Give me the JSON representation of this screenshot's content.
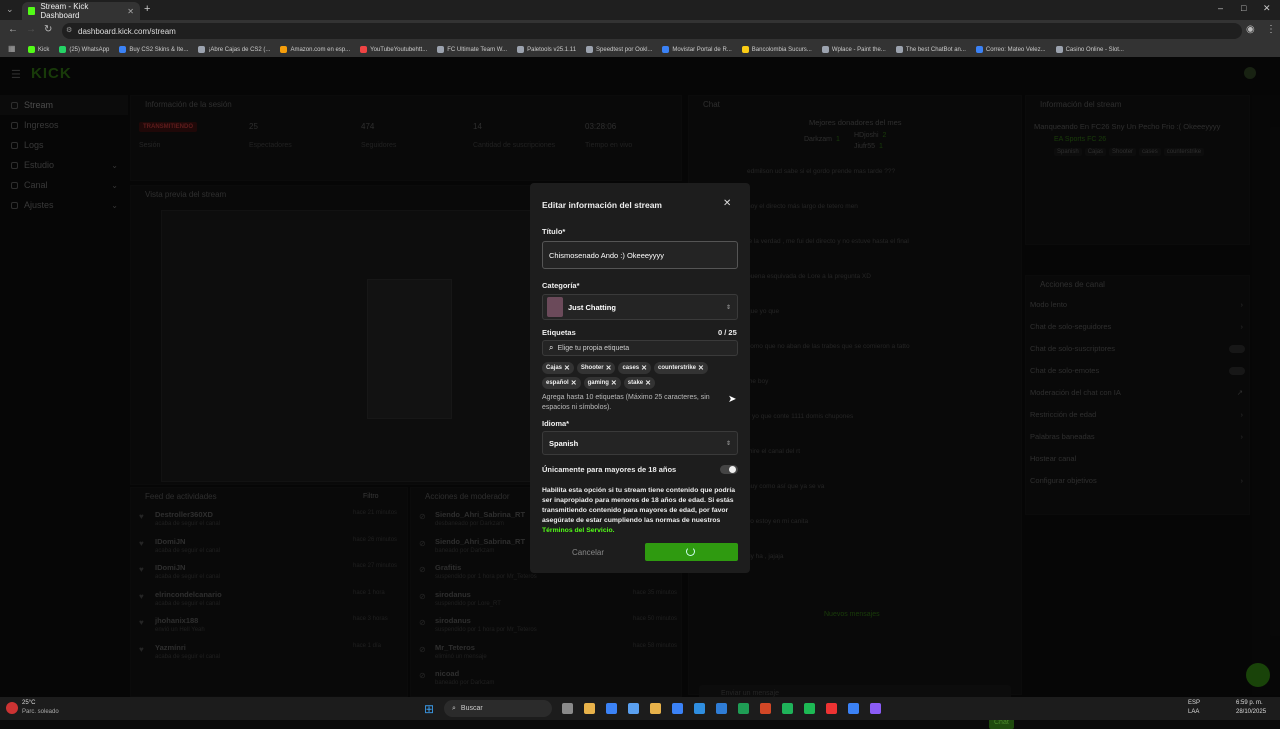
{
  "browser": {
    "tab_title": "Stream - Kick Dashboard",
    "new_tab": "+",
    "url": "dashboard.kick.com/stream",
    "window_controls": [
      "–",
      "□",
      "✕"
    ],
    "bookmarks": [
      {
        "label": "Kick",
        "color": "#53fc18"
      },
      {
        "label": "(25) WhatsApp",
        "color": "#25d366"
      },
      {
        "label": "Buy CS2 Skins & Ite...",
        "color": "#3b82f6"
      },
      {
        "label": "¡Abre Cajas de CS2 (...",
        "color": "#9ca3af"
      },
      {
        "label": "Amazon.com en esp...",
        "color": "#f59e0b"
      },
      {
        "label": "YouTubeYoutubehtt...",
        "color": "#ef4444"
      },
      {
        "label": "FC Ultimate Team W...",
        "color": "#9ca3af"
      },
      {
        "label": "Paletools v25.1.11",
        "color": "#9ca3af"
      },
      {
        "label": "Speedtest por Ookl...",
        "color": "#9ca3af"
      },
      {
        "label": "Movistar Portal de R...",
        "color": "#3b82f6"
      },
      {
        "label": "Bancolombia Sucurs...",
        "color": "#facc15"
      },
      {
        "label": "Wplace - Paint the...",
        "color": "#9ca3af"
      },
      {
        "label": "The best ChatBot an...",
        "color": "#9ca3af"
      },
      {
        "label": "Correo: Mateo Velez...",
        "color": "#3b82f6"
      },
      {
        "label": "Casino Online - Slot...",
        "color": "#9ca3af"
      }
    ]
  },
  "app": {
    "logo": "KICK",
    "sidebar": [
      {
        "label": "Stream",
        "icon": "video-icon",
        "active": true
      },
      {
        "label": "Ingresos",
        "icon": "dollar-icon"
      },
      {
        "label": "Logs",
        "icon": "list-icon"
      },
      {
        "label": "Estudio",
        "icon": "studio-icon",
        "chevron": true
      },
      {
        "label": "Canal",
        "icon": "channel-icon",
        "chevron": true
      },
      {
        "label": "Ajustes",
        "icon": "gear-icon",
        "chevron": true
      }
    ],
    "session": {
      "title": "Información de la sesión",
      "status": "TRANSMITIENDO",
      "stats": [
        {
          "value": "25",
          "label": "Espectadores"
        },
        {
          "value": "474",
          "label": "Seguidores"
        },
        {
          "value": "14",
          "label": "Cantidad de suscripciones"
        },
        {
          "value": "03:28:06",
          "label": "Tiempo en vivo"
        }
      ],
      "session_label": "Sesión"
    },
    "preview_title": "Vista previa del stream",
    "activity": {
      "title": "Feed de actividades",
      "filter": "Filtro",
      "items": [
        {
          "name": "Destroller360XD",
          "desc": "acaba de seguir el canal",
          "time": "hace 21 minutos"
        },
        {
          "name": "IDomiJN",
          "desc": "acaba de seguir el canal",
          "time": "hace 26 minutos"
        },
        {
          "name": "IDomiJN",
          "desc": "acaba de seguir el canal",
          "time": "hace 27 minutos"
        },
        {
          "name": "elrincondelcanario",
          "desc": "acaba de seguir el canal",
          "time": "hace 1 hora"
        },
        {
          "name": "jhohanix188",
          "desc": "envió un Hell Yeah",
          "time": "hace 3 horas"
        },
        {
          "name": "Yazmínri",
          "desc": "acaba de seguir el canal",
          "time": "hace 1 día"
        }
      ]
    },
    "mod_actions": {
      "title": "Acciones de moderador",
      "items": [
        {
          "name": "Siendo_Ahri_Sabrina_RT",
          "desc": "desbaneado por Darkzam"
        },
        {
          "name": "Siendo_Ahri_Sabrina_RT",
          "desc": "baneado por Darkzam"
        },
        {
          "name": "Grafitis",
          "desc": "suspendido por 1 hora por Mr_Teteros"
        },
        {
          "name": "sirodanus",
          "desc": "suspendido por Lore_RT",
          "time": "hace 35 minutos"
        },
        {
          "name": "sirodanus",
          "desc": "suspendido por 1 hora por Mr_Teteros",
          "time": "hace 50 minutos"
        },
        {
          "name": "Mr_Teteros",
          "desc": "eliminó un mensaje",
          "time": "hace 58 minutos"
        },
        {
          "name": "nicoad",
          "desc": "baneado por Darkzam"
        }
      ]
    },
    "chat": {
      "title": "Chat",
      "donors_title": "Mejores donadores del mes",
      "donors": [
        {
          "name": "Darkzam",
          "count": "1"
        },
        {
          "name": "HDjoshi",
          "count": "2"
        },
        {
          "name": "Jiufr55",
          "count": "1"
        }
      ],
      "new_messages": "Nuevos mensajes",
      "input_placeholder": "Enviar un mensaje",
      "send": "Chat",
      "messages": [
        "edmilson ud sabe si el gordo prende mas tarde ???",
        "hoy el directo más largo de tetero men",
        "le la verdad , me fui del directo y no estuve hasta el final",
        "buena esquivada de Lore a la pregunta XD",
        "que yo que",
        "como que no aban de las trabes que se comieron a tatto",
        "me boy",
        "y yo que conte 1111 domis chupones",
        "mire el canal del rt",
        "huy como así que ya se va",
        "yo estoy en mi canita",
        "uy ha , jajaja"
      ]
    },
    "stream_info": {
      "title": "Información del stream",
      "stream_title": "Manqueando En FC26 Sny Un Pecho Frio :( Okeeeyyyy",
      "game": "EA Sports FC 26",
      "tags": [
        "Spanish",
        "Cajas",
        "Shooter",
        "cases",
        "counterstrike"
      ]
    },
    "channel_actions": {
      "title": "Acciones de canal",
      "items": [
        {
          "label": "Modo lento",
          "type": "chevron"
        },
        {
          "label": "Chat de solo-seguidores",
          "type": "chevron"
        },
        {
          "label": "Chat de solo-suscriptores",
          "type": "toggle"
        },
        {
          "label": "Chat de solo-emotes",
          "type": "toggle"
        },
        {
          "label": "Moderación del chat con IA",
          "type": "link"
        },
        {
          "label": "Restricción de edad",
          "type": "chevron"
        },
        {
          "label": "Palabras baneadas",
          "type": "chevron"
        },
        {
          "label": "Hostear canal",
          "type": "none"
        },
        {
          "label": "Configurar objetivos",
          "type": "chevron"
        }
      ]
    }
  },
  "modal": {
    "title": "Editar información del stream",
    "close": "✕",
    "title_label": "Título*",
    "title_value": "Chismosenado Ando :) Okeeeyyyy",
    "category_label": "Categoría*",
    "category_value": "Just Chatting",
    "tags_label": "Etiquetas",
    "tags_count": "0 / 25",
    "tags_placeholder": "Elige tu propia etiqueta",
    "tags_row1": [
      "Cajas",
      "Shooter",
      "cases",
      "counterstrike"
    ],
    "tags_row2": [
      "español",
      "gaming",
      "stake"
    ],
    "tags_hint": "Agrega hasta 10 etiquetas (Máximo 25 caracteres, sin espacios ni símbolos).",
    "language_label": "Idioma*",
    "language_value": "Spanish",
    "adult_label": "Únicamente para mayores de 18 años",
    "adult_desc": "Habilita esta opción si tu stream tiene contenido que podría ser inapropiado para menores de 18 años de edad. Si estás transmitiendo contenido para mayores de edad, por favor asegúrate de estar cumpliendo las normas de nuestros ",
    "terms_link": "Términos del Servicio.",
    "cancel": "Cancelar",
    "accent": "#53fc18"
  },
  "taskbar": {
    "weather_temp": "25°C",
    "weather_desc": "Parc. soleado",
    "search": "Buscar",
    "lang": "ESP",
    "lang2": "LAA",
    "time": "6:59 p. m.",
    "date": "28/10/2025"
  }
}
